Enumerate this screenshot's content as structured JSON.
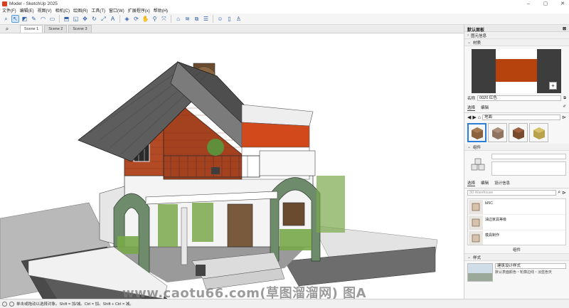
{
  "window": {
    "title": "Model - SketchUp 2025",
    "controls": [
      "–",
      "▢",
      "✕"
    ]
  },
  "menu": [
    "文件(F)",
    "编辑(E)",
    "视图(V)",
    "相机(C)",
    "绘图(R)",
    "工具(T)",
    "窗口(W)",
    "扩展程序(x)",
    "帮助(H)"
  ],
  "scenes": {
    "tabs": [
      "Scene 1",
      "Scene 2",
      "Scene 3"
    ],
    "active": 0
  },
  "viewport": {
    "watermark": "www.caotu66.com(草图溜溜网) 图A"
  },
  "status": {
    "hint": "单击或拖动以选择对象。Shift = 加/减。Ctrl = 加。Shift + Ctrl = 减。"
  },
  "panel": {
    "title": "默认面板",
    "entity_info": "图元信息",
    "materials": {
      "header": "材质",
      "swatch_color": "#b6430e",
      "name_label": "名称",
      "name_value": "0020 红色",
      "tabs": [
        "选择",
        "编辑"
      ],
      "library": "地面"
    },
    "components": {
      "header": "组件",
      "tabs": [
        "选择",
        "编辑",
        "设计信息"
      ],
      "search_placeholder": "3D Warehouse",
      "items": [
        "Ы5С",
        "油边家具等级",
        "模具制作"
      ],
      "footer": "组件"
    },
    "styles": {
      "header": "样式",
      "name": "建筑设计样式",
      "desc": "默认表面颜色・轮廓边线・淡蓝色天"
    }
  }
}
